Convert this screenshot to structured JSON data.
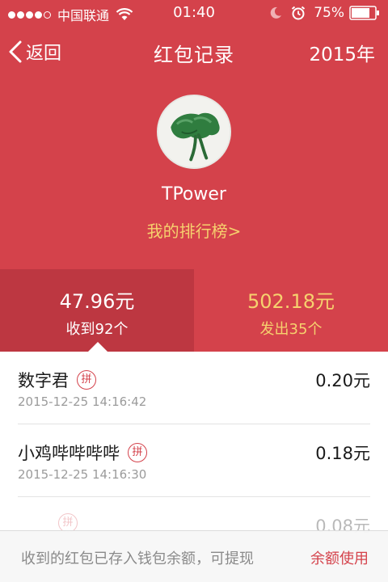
{
  "status_bar": {
    "carrier": "中国联通",
    "time": "01:40",
    "battery": "75%"
  },
  "nav": {
    "back_label": "返回",
    "title": "红包记录",
    "year": "2015年"
  },
  "profile": {
    "username": "TPower",
    "ranking_link": "我的排行榜>"
  },
  "summary": {
    "received_amount": "47.96元",
    "received_label": "收到92个",
    "sent_amount": "502.18元",
    "sent_label": "发出35个"
  },
  "records": [
    {
      "name": "数字君",
      "badge": "拼",
      "time": "2015-12-25 14:16:42",
      "amount": "0.20元"
    },
    {
      "name": "小鸡哔哔哔哔",
      "badge": "拼",
      "time": "2015-12-25 14:16:30",
      "amount": "0.18元"
    },
    {
      "name": "",
      "badge": "拼",
      "time": "",
      "amount": "0.08元"
    }
  ],
  "bottom_bar": {
    "note": "收到的红包已存入钱包余额，可提现",
    "link": "余额使用"
  },
  "colors": {
    "header_red": "#d4424b",
    "selected_tab": "#bd3741",
    "gold_text": "#f6d16e"
  },
  "icons": [
    "wifi-icon",
    "moon-icon",
    "alarm-icon",
    "battery-icon",
    "back-chevron-icon",
    "avatar-image"
  ]
}
